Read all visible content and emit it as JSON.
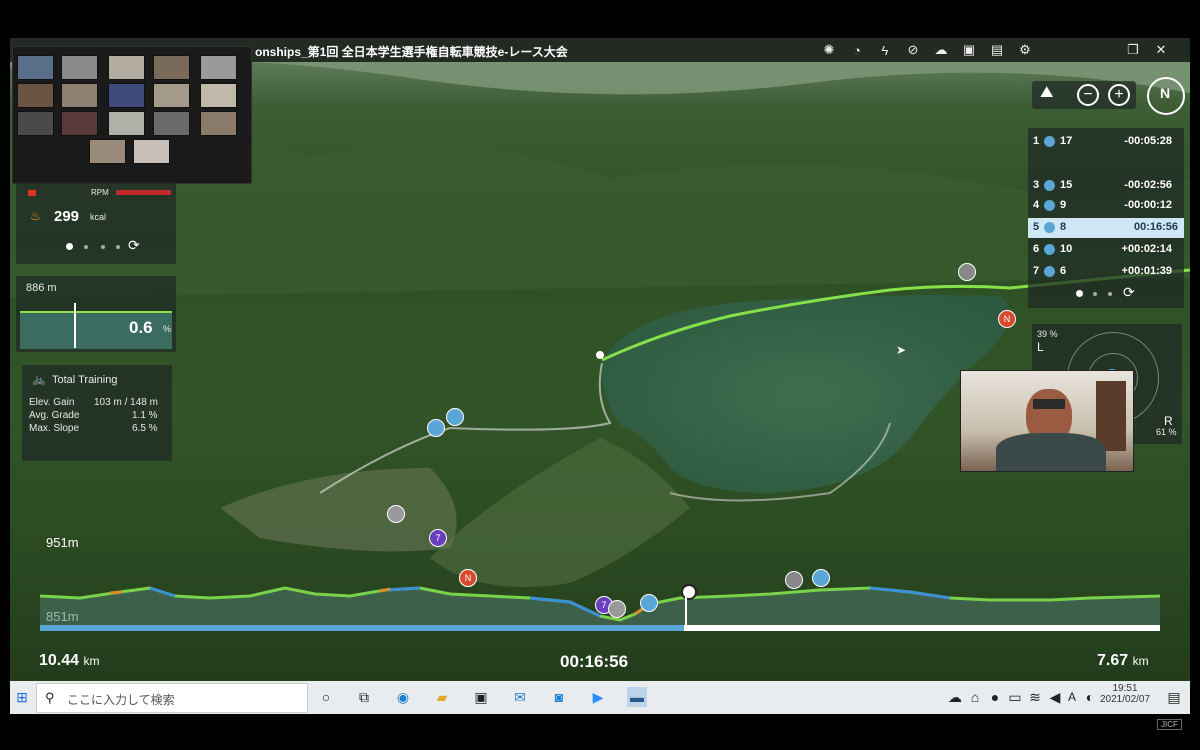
{
  "window": {
    "title": "onships_第1回 全日本学生選手権自転車競技e-レース大会",
    "restore_icon": "restore-window-icon",
    "close_icon": "close-icon"
  },
  "stats": {
    "kcal_value": "299",
    "kcal_unit": "kcal",
    "rpm_label": "RPM",
    "elevation": "886 m",
    "grade": "0.6",
    "grade_unit": "%",
    "training_title": "Total Training",
    "elev_gain_label": "Elev. Gain",
    "elev_gain_value": "103 m /  148 m",
    "avg_grade_label": "Avg. Grade",
    "avg_grade_value": "1.1 %",
    "max_slope_label": "Max. Slope",
    "max_slope_value": "6.5 %"
  },
  "leaderboard": [
    {
      "pos": "1",
      "rider": "17",
      "gap": "-00:05:28",
      "active": false
    },
    {
      "pos": "3",
      "rider": "15",
      "gap": "-00:02:56",
      "active": false
    },
    {
      "pos": "4",
      "rider": "9",
      "gap": "-00:00:12",
      "active": false
    },
    {
      "pos": "5",
      "rider": "8",
      "gap": "00:16:56",
      "active": true
    },
    {
      "pos": "6",
      "rider": "10",
      "gap": "+00:02:14",
      "active": false
    },
    {
      "pos": "7",
      "rider": "6",
      "gap": "+00:01:39",
      "active": false
    }
  ],
  "compass": {
    "left_label": "L",
    "left_pct": "39 %",
    "right_label": "R",
    "right_pct": "61 %",
    "north": "N"
  },
  "profile": {
    "max_elev": "951m",
    "min_elev": "851m",
    "progress": 0.575
  },
  "bottom": {
    "distance_done": "10.44",
    "distance_left": "7.67",
    "unit": "km",
    "elapsed": "00:16:56"
  },
  "markers": {
    "n": "N",
    "seven": "7"
  },
  "taskbar": {
    "search_placeholder": "ここに入力して検索",
    "time": "19:51",
    "date": "2021/02/07",
    "lang": "A"
  },
  "watermark": "JICF"
}
